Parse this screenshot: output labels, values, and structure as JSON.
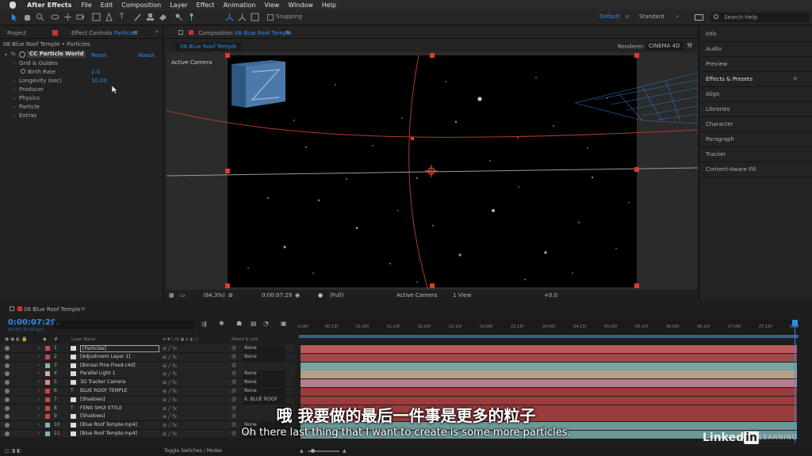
{
  "menubar": {
    "app_name": "After Effects",
    "menus": [
      "File",
      "Edit",
      "Composition",
      "Layer",
      "Effect",
      "Animation",
      "View",
      "Window",
      "Help"
    ]
  },
  "toolbar": {
    "snapping_label": "Snapping",
    "workspace_default": "Default",
    "workspace_standard": "Standard",
    "search_placeholder": "Search Help"
  },
  "left_panel": {
    "tab_project": "Project",
    "tab_effect_controls_prefix": "Effect Controls",
    "tab_effect_controls_layer": "Particles",
    "header": "08 Blue Roof Temple • Particles",
    "effect_name": "CC Particle World",
    "reset_label": "Reset",
    "about_label": "About",
    "properties": [
      {
        "label": "Grid & Guides",
        "value": ""
      },
      {
        "label": "Birth Rate",
        "value": "2.0"
      },
      {
        "label": "Longevity (sec)",
        "value": "10.00"
      },
      {
        "label": "Producer",
        "value": ""
      },
      {
        "label": "Physics",
        "value": ""
      },
      {
        "label": "Particle",
        "value": ""
      },
      {
        "label": "Extras",
        "value": ""
      }
    ]
  },
  "comp_panel": {
    "tab_prefix": "Composition",
    "tab_name": "08 Blue Roof Temple",
    "title_tab": "08 Blue Roof Temple",
    "renderer_label": "Renderer:",
    "renderer_value": "CINEMA 4D",
    "view_label": "Active Camera",
    "footer": {
      "zoom": "(84.3%)",
      "timecode": "0:00:07:29",
      "resolution": "(Full)",
      "camera": "Active Camera",
      "views": "1 View",
      "exposure": "+0.0"
    }
  },
  "right_panel": {
    "items": [
      "Info",
      "Audio",
      "Preview",
      "Effects & Presets",
      "Align",
      "Libraries",
      "Character",
      "Paragraph",
      "Tracker",
      "Content-Aware Fill"
    ]
  },
  "timeline": {
    "tab": "08 Blue Roof Temple",
    "timecode": "0:00:07:29",
    "frame_info": "00239 (30.00 fps)",
    "column_layer_name": "Layer Name",
    "column_parent": "Parent & Link",
    "ruler": [
      "0:00f",
      "00:15f",
      "01:00f",
      "01:15f",
      "02:00f",
      "02:15f",
      "03:00f",
      "03:15f",
      "04:00f",
      "04:15f",
      "05:00f",
      "05:15f",
      "06:00f",
      "06:15f",
      "07:00f",
      "07:15f",
      "08:0"
    ],
    "toggle_label": "Toggle Switches / Modes",
    "layers": [
      {
        "num": "1",
        "type": "",
        "name": "[Particles]",
        "parent": "None",
        "color": "#c84a4a",
        "bar": "#b85a5a"
      },
      {
        "num": "2",
        "type": "",
        "name": "[Adjustment Layer 1]",
        "parent": "None",
        "color": "#cc4444",
        "bar": "#9a4a4a"
      },
      {
        "num": "3",
        "type": "",
        "name": "[Bonsai Pine Fixed.c4d]",
        "parent": "",
        "color": "#88b0b0",
        "bar": "#7aa3a3"
      },
      {
        "num": "4",
        "type": "",
        "name": "Parallel Light 1",
        "parent": "None",
        "color": "#d2b28c",
        "bar": "#b5a08a"
      },
      {
        "num": "5",
        "type": "",
        "name": "3D Tracker Camera",
        "parent": "None",
        "color": "#d58aa0",
        "bar": "#b27f8f"
      },
      {
        "num": "6",
        "type": "T",
        "name": "BLUE ROOF TEMPLE",
        "parent": "None",
        "color": "#cc4444",
        "bar": "#9b3c3c"
      },
      {
        "num": "7",
        "type": "",
        "name": "[Shadows]",
        "parent": "6. BLUE ROOF",
        "color": "#cc4444",
        "bar": "#9b3c3c"
      },
      {
        "num": "8",
        "type": "T",
        "name": "FENG SHUI STYLE",
        "parent": "",
        "color": "#cc4444",
        "bar": "#9b3c3c"
      },
      {
        "num": "9",
        "type": "",
        "name": "[Shadows]",
        "parent": "",
        "color": "#cc4444",
        "bar": "#9b3c3c"
      },
      {
        "num": "10",
        "type": "",
        "name": "[Blue Roof Temple.mp4]",
        "parent": "None",
        "color": "#88b0b0",
        "bar": "#6e9898"
      },
      {
        "num": "11",
        "type": "",
        "name": "[Blue Roof Temple.mp4]",
        "parent": "None",
        "color": "#88b0b0",
        "bar": "#6e9898"
      }
    ]
  },
  "subtitles": {
    "chinese": "哦 我要做的最后一件事是更多的粒子",
    "english": "Oh there last thing that I want to create is some more particles."
  },
  "watermark": {
    "linked": "Linked",
    "in": "in",
    "learning": "LEARNING"
  }
}
